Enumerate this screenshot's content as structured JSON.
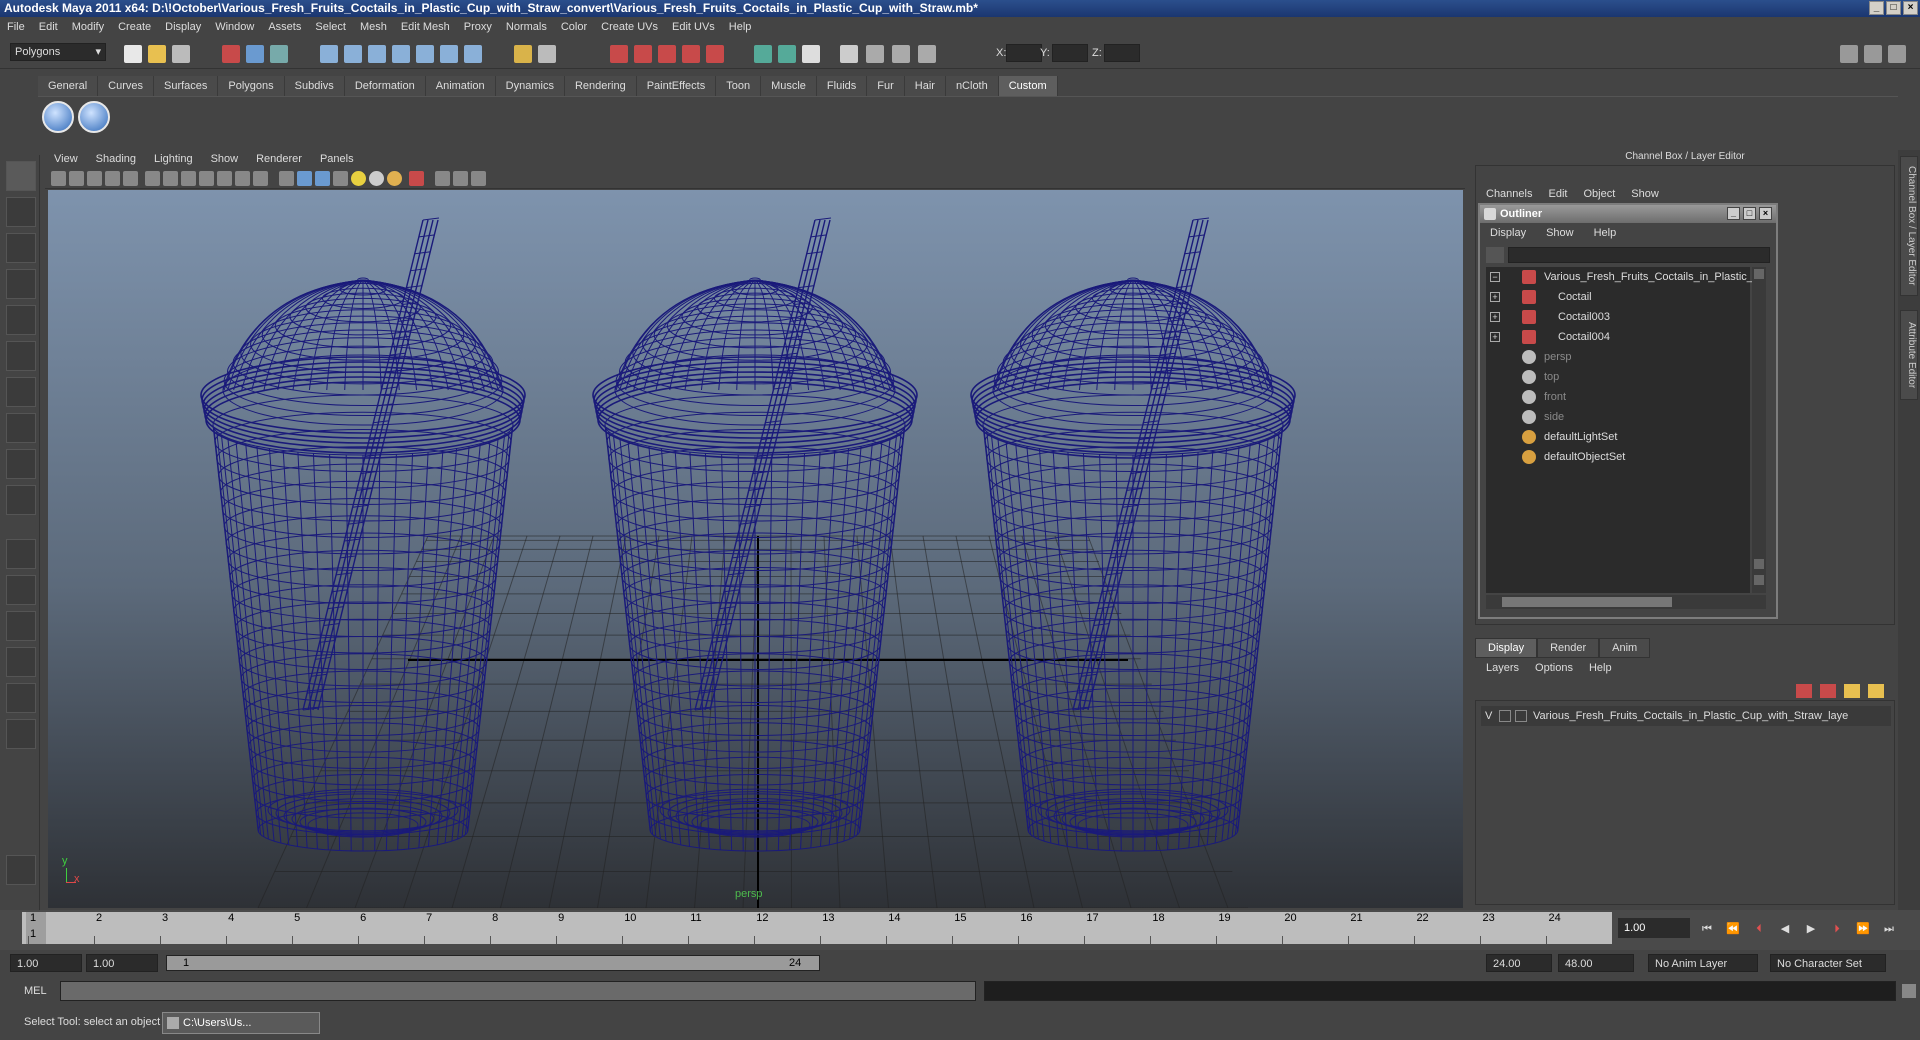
{
  "window": {
    "title": "Autodesk Maya 2011 x64: D:\\!October\\Various_Fresh_Fruits_Coctails_in_Plastic_Cup_with_Straw_convert\\Various_Fresh_Fruits_Coctails_in_Plastic_Cup_with_Straw.mb*"
  },
  "menubar": [
    "File",
    "Edit",
    "Modify",
    "Create",
    "Display",
    "Window",
    "Assets",
    "Select",
    "Mesh",
    "Edit Mesh",
    "Proxy",
    "Normals",
    "Color",
    "Create UVs",
    "Edit UVs",
    "Help"
  ],
  "statusline": {
    "mode": "Polygons",
    "x_label": "X:",
    "y_label": "Y:",
    "z_label": "Z:"
  },
  "shelf": {
    "tabs": [
      "General",
      "Curves",
      "Surfaces",
      "Polygons",
      "Subdivs",
      "Deformation",
      "Animation",
      "Dynamics",
      "Rendering",
      "PaintEffects",
      "Toon",
      "Muscle",
      "Fluids",
      "Fur",
      "Hair",
      "nCloth",
      "Custom"
    ],
    "active_tab": "Custom"
  },
  "viewport": {
    "menu": [
      "View",
      "Shading",
      "Lighting",
      "Show",
      "Renderer",
      "Panels"
    ],
    "camera_label": "persp",
    "axis_y": "y",
    "axis_x": "x",
    "wire_color": "#1a1a7a"
  },
  "channel_box": {
    "header": "Channel Box / Layer Editor",
    "menu": [
      "Channels",
      "Edit",
      "Object",
      "Show"
    ],
    "side_tabs": [
      "Channel Box / Layer Editor",
      "Attribute Editor"
    ]
  },
  "outliner": {
    "title": "Outliner",
    "menu": [
      "Display",
      "Show",
      "Help"
    ],
    "items": [
      {
        "label": "Various_Fresh_Fruits_Coctails_in_Plastic_C",
        "expander": "−",
        "icon": "transform-icon",
        "dim": false
      },
      {
        "label": "Coctail",
        "expander": "+",
        "icon": "transform-icon",
        "dim": false
      },
      {
        "label": "Coctail003",
        "expander": "+",
        "icon": "transform-icon",
        "dim": false
      },
      {
        "label": "Coctail004",
        "expander": "+",
        "icon": "transform-icon",
        "dim": false
      },
      {
        "label": "persp",
        "expander": "",
        "icon": "camera-icon",
        "dim": true
      },
      {
        "label": "top",
        "expander": "",
        "icon": "camera-icon",
        "dim": true
      },
      {
        "label": "front",
        "expander": "",
        "icon": "camera-icon",
        "dim": true
      },
      {
        "label": "side",
        "expander": "",
        "icon": "camera-icon",
        "dim": true
      },
      {
        "label": "defaultLightSet",
        "expander": "",
        "icon": "set-icon",
        "dim": false
      },
      {
        "label": "defaultObjectSet",
        "expander": "",
        "icon": "set-icon",
        "dim": false
      }
    ]
  },
  "layer_editor": {
    "tabs": [
      "Display",
      "Render",
      "Anim"
    ],
    "active_tab": "Display",
    "menu": [
      "Layers",
      "Options",
      "Help"
    ],
    "layer_visible": "V",
    "layer_name": "Various_Fresh_Fruits_Coctails_in_Plastic_Cup_with_Straw_laye"
  },
  "timeline": {
    "ticks": [
      "1",
      "2",
      "3",
      "4",
      "5",
      "6",
      "7",
      "8",
      "9",
      "10",
      "11",
      "12",
      "13",
      "14",
      "15",
      "16",
      "17",
      "18",
      "19",
      "20",
      "21",
      "22",
      "23",
      "24"
    ],
    "current_frame": "1.00",
    "playhead_label": "1"
  },
  "range": {
    "start": "1.00",
    "start2": "1.00",
    "slider_start": "1",
    "slider_end": "24",
    "end": "24.00",
    "end2": "48.00",
    "anim_layer": "No Anim Layer",
    "char_set": "No Character Set"
  },
  "mel": {
    "label": "MEL"
  },
  "help": {
    "text": "Select Tool: select an object",
    "taskbar_item": "C:\\Users\\Us..."
  }
}
